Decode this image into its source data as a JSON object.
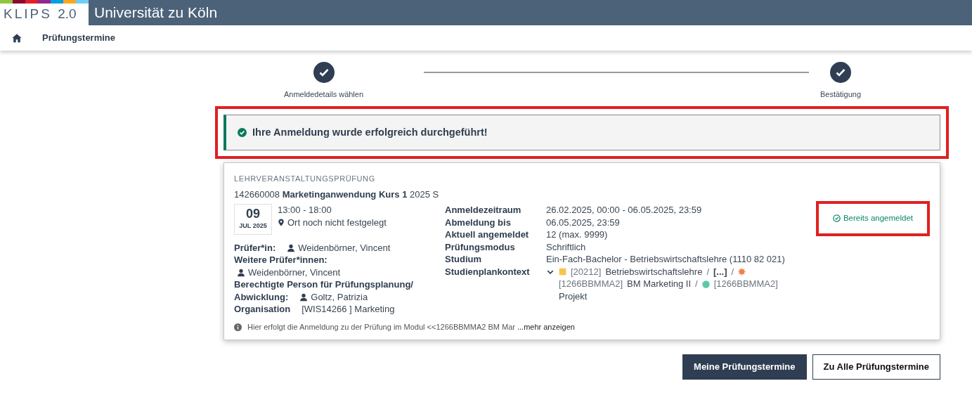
{
  "header": {
    "logo_text": "KLIPS",
    "logo_version": "2.0",
    "university": "Universität zu Köln"
  },
  "breadcrumb": {
    "label": "Prüfungstermine"
  },
  "steps": [
    {
      "label": "Anmeldedetails wählen",
      "done": true
    },
    {
      "label": "Bestätigung",
      "done": true
    }
  ],
  "alert": {
    "text": "Ihre Anmeldung wurde erfolgreich durchgeführt!",
    "highlighted": true
  },
  "exam": {
    "type_label": "LEHRVERANSTALTUNGSPRÜFUNG",
    "number": "142660008",
    "title": "Marketinganwendung Kurs 1",
    "semester": "2025 S",
    "date": {
      "day": "09",
      "month_year": "JUL 2025"
    },
    "time": "13:00 - 18:00",
    "location": "Ort noch nicht festgelegt",
    "people": [
      {
        "label_lines": [
          "Prüfer*in:"
        ],
        "person": "Weidenbörner, Vincent",
        "kind": "inline"
      },
      {
        "label_lines": [
          "Weitere Prüfer*innen:"
        ],
        "person": "Weidenbörner, Vincent",
        "kind": "below"
      },
      {
        "label_lines": [
          "Berechtigte Person für Prüfungsplanung/",
          "Abwicklung:"
        ],
        "person": "Goltz, Patrizia",
        "kind": "inline"
      }
    ],
    "organisation": {
      "label": "Organisation",
      "value": "[WIS14266 ] Marketing"
    },
    "details": [
      {
        "label": "Anmeldezeitraum",
        "value": "26.02.2025, 00:00 - 06.05.2025, 23:59"
      },
      {
        "label": "Abmeldung bis",
        "value": "06.05.2025, 23:59"
      },
      {
        "label": "Aktuell angemeldet",
        "value": "12 (max. 9999)"
      },
      {
        "label": "Prüfungsmodus",
        "value": "Schriftlich"
      },
      {
        "label": "Studium",
        "value": "Ein-Fach-Bachelor - Betriebswirtschaftslehre (1110 82 021)"
      }
    ],
    "context": {
      "label": "Studienplankontext",
      "separator": "/",
      "items": [
        {
          "kind": "square",
          "color": "#f5c451",
          "code": "[20212]",
          "name": "Betriebswirtschaftslehre"
        },
        {
          "kind": "ellipsis",
          "name": "[...]"
        },
        {
          "kind": "star",
          "color": "#f0834a",
          "code": "[1266BBMMA2]",
          "name": "BM Marketing II"
        },
        {
          "kind": "dot",
          "color": "#5bc8a8",
          "code": "[1266BBMMA2]",
          "name": "Projekt"
        }
      ]
    },
    "status": {
      "text": "Bereits angemeldet",
      "highlighted": true
    },
    "note": {
      "text": "Hier erfolgt die Anmeldung zu der Prüfung im Modul <<1266BBMMA2 BM Mar",
      "link": "...mehr anzeigen"
    }
  },
  "buttons": [
    {
      "label": "Meine Prüfungstermine",
      "kind": "primary"
    },
    {
      "label": "Zu Alle Prüfungstermine",
      "kind": "outline"
    }
  ]
}
